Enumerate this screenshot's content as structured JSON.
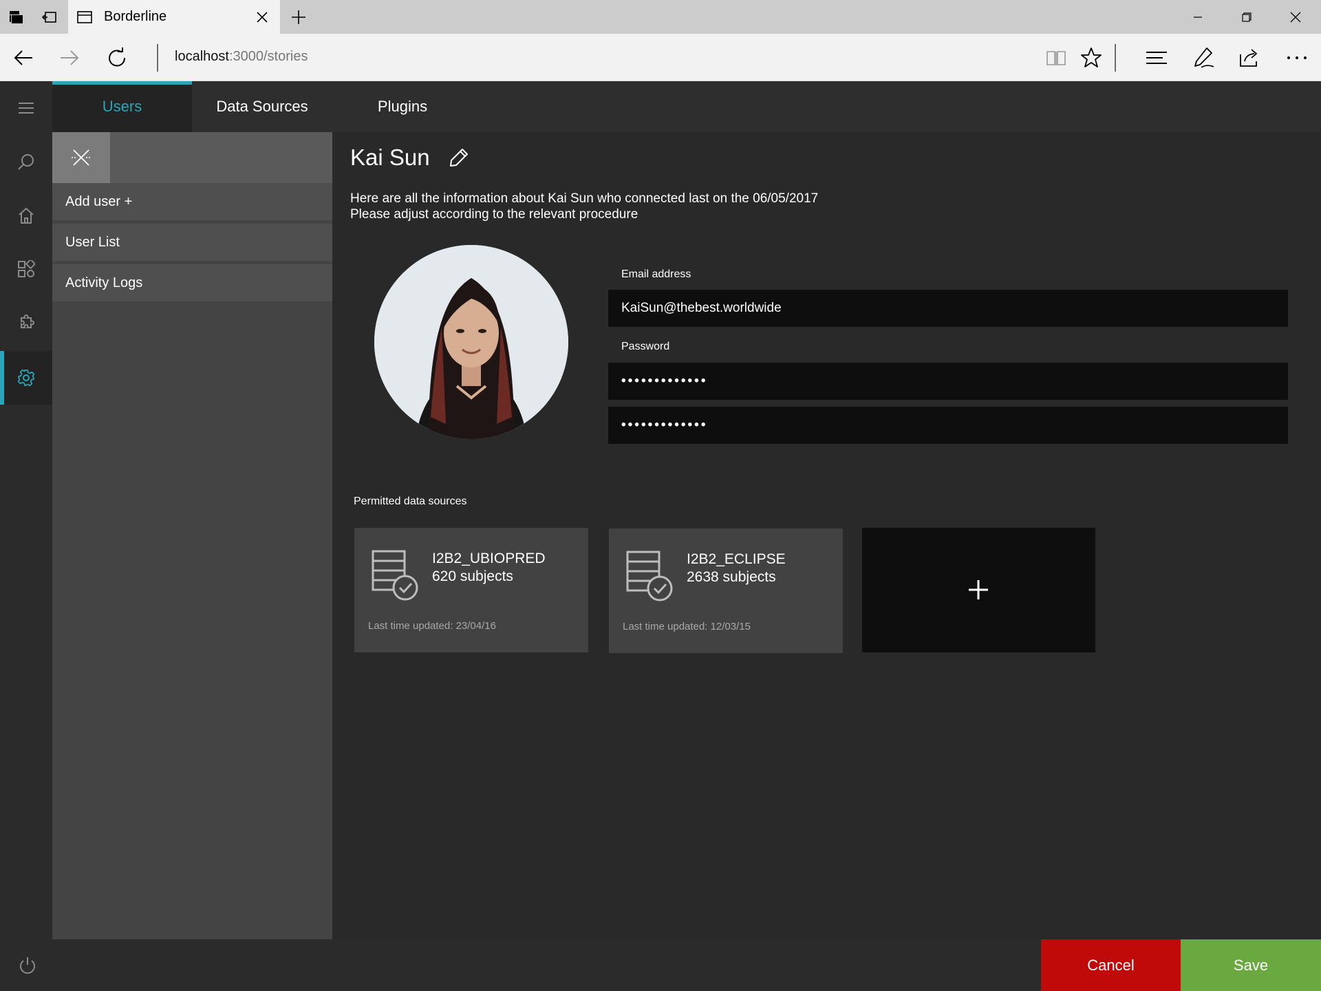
{
  "browser": {
    "tab_title": "Borderline",
    "url_host": "localhost",
    "url_path": ":3000/stories",
    "icons": [
      "tab-actions-icon",
      "back-tabs-icon",
      "window-icon",
      "close-icon",
      "plus-icon",
      "minimize-icon",
      "restore-icon",
      "close-window-icon",
      "back-arrow-icon",
      "forward-arrow-icon",
      "refresh-icon",
      "reading-view-icon",
      "star-icon",
      "hub-icon",
      "pen-icon",
      "share-icon",
      "more-icon"
    ]
  },
  "rail": {
    "items": [
      "menu-icon",
      "search-icon",
      "home-icon",
      "apps-icon",
      "puzzle-icon",
      "gear-icon",
      "power-icon"
    ],
    "accent": "#2aa6b8"
  },
  "tabs": [
    {
      "label": "Users"
    },
    {
      "label": "Data Sources"
    },
    {
      "label": "Plugins"
    }
  ],
  "subnav": {
    "items": [
      {
        "label": "Add user +"
      },
      {
        "label": "User List"
      },
      {
        "label": "Activity Logs"
      }
    ]
  },
  "user": {
    "name": "Kai Sun",
    "intro_line1": "Here are all the information about Kai Sun who connected last on the 06/05/2017",
    "intro_line2": "Please adjust according to the relevant procedure",
    "email_label": "Email address",
    "email_value": "KaiSun@thebest.worldwide",
    "password_label": "Password",
    "password_value": "•••••••••••••",
    "password_confirm_value": "•••••••••••••"
  },
  "data_sources": {
    "label": "Permitted data sources",
    "items": [
      {
        "name": "I2B2_UBIOPRED",
        "subjects": "620 subjects",
        "updated": "Last time updated: 23/04/16"
      },
      {
        "name": "I2B2_ECLIPSE",
        "subjects": "2638 subjects",
        "updated": "Last time updated: 12/03/15"
      }
    ]
  },
  "actions": {
    "cancel": "Cancel",
    "save": "Save",
    "cancel_color": "#c00a0a",
    "save_color": "#6aa840"
  }
}
